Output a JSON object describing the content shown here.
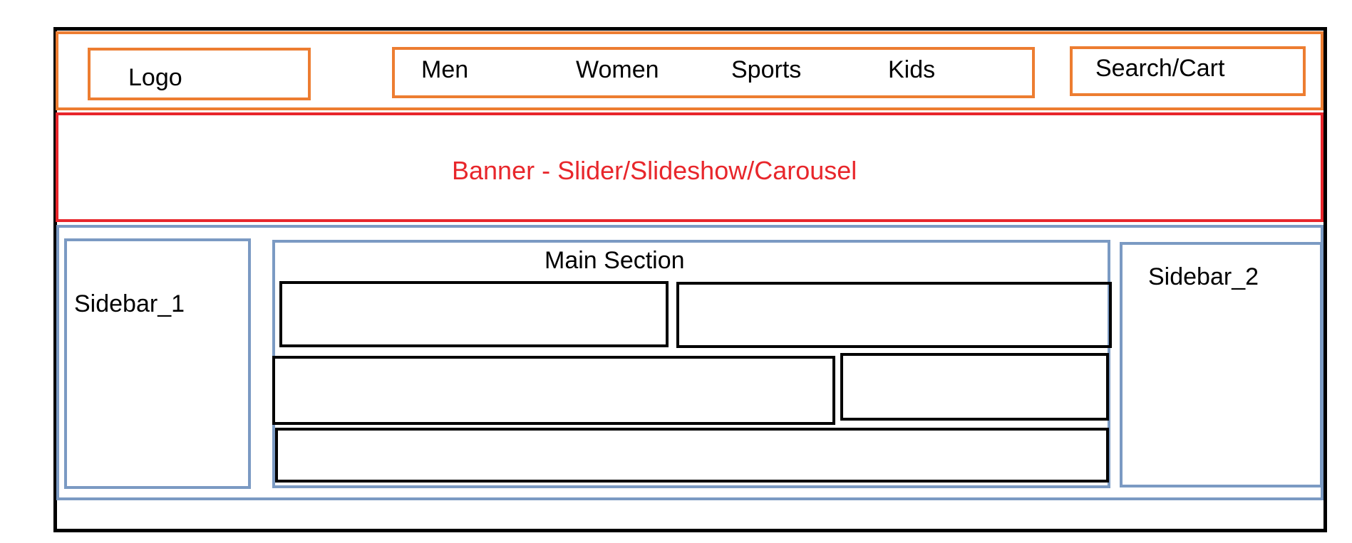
{
  "header": {
    "logo": "Logo",
    "nav": [
      "Men",
      "Women",
      "Sports",
      "Kids"
    ],
    "search_cart": "Search/Cart"
  },
  "banner": {
    "label": "Banner - Slider/Slideshow/Carousel"
  },
  "content": {
    "sidebar_1": "Sidebar_1",
    "main_section": "Main Section",
    "sidebar_2": "Sidebar_2"
  },
  "colors": {
    "header_border": "#ed7d31",
    "banner_border": "#e8262b",
    "banner_text": "#e8262b",
    "content_border": "#7b9ac3",
    "block_border": "#000000",
    "frame_border": "#000000"
  }
}
